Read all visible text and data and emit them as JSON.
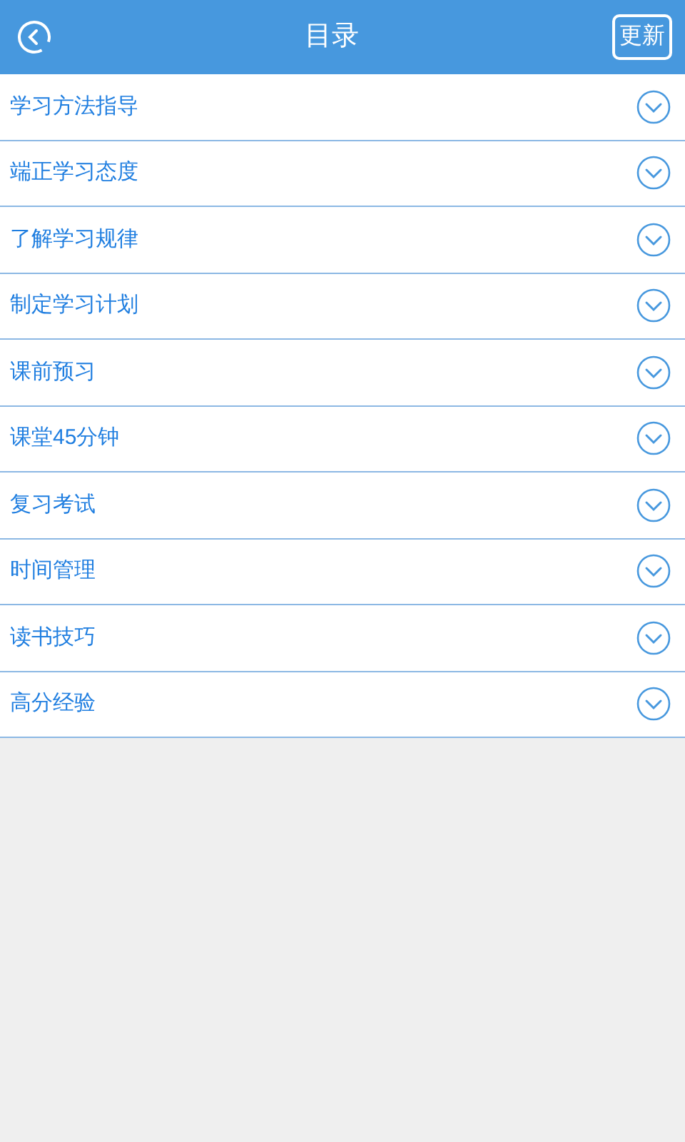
{
  "header": {
    "title": "目录",
    "action": "更新"
  },
  "items": [
    {
      "label": "学习方法指导"
    },
    {
      "label": "端正学习态度"
    },
    {
      "label": "了解学习规律"
    },
    {
      "label": "制定学习计划"
    },
    {
      "label": "课前预习"
    },
    {
      "label": "课堂45分钟"
    },
    {
      "label": "复习考试"
    },
    {
      "label": "时间管理"
    },
    {
      "label": "读书技巧"
    },
    {
      "label": "高分经验"
    }
  ]
}
